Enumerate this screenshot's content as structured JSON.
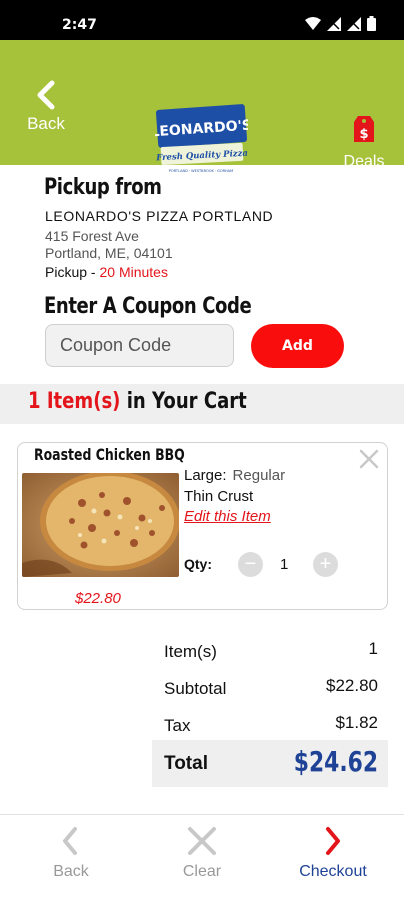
{
  "status_bar": {
    "time": "2:47"
  },
  "header": {
    "back_label": "Back",
    "deals_label": "Deals",
    "logo_text": "LEONARDO'S",
    "logo_tagline": "Fresh Quality Pizza",
    "logo_subtagline": "PORTLAND · WESTBROOK · GORHAM",
    "accent_color": "#a6c13a"
  },
  "pickup": {
    "title": "Pickup from",
    "store_name": "LEONARDO'S PIZZA PORTLAND",
    "address_line1": "415 Forest Ave",
    "address_line2": "Portland, ME, 04101",
    "method": "Pickup",
    "separator": " - ",
    "time": "20 Minutes"
  },
  "coupon": {
    "title": "Enter A Coupon Code",
    "placeholder": "Coupon Code",
    "add_label": "Add"
  },
  "cart": {
    "count": "1 Item(s)",
    "heading_suffix": " in Your Cart",
    "items": [
      {
        "name": "Roasted Chicken BBQ",
        "size_label": "Large:",
        "size_value": "Regular",
        "crust": "Thin Crust",
        "edit_label": "Edit this Item",
        "qty_label": "Qty:",
        "quantity": "1",
        "price": "$22.80"
      }
    ]
  },
  "summary": {
    "items_label": "Item(s)",
    "items_value": "1",
    "subtotal_label": "Subtotal",
    "subtotal_value": "$22.80",
    "tax_label": "Tax",
    "tax_value": "$1.82",
    "total_label": "Total",
    "total_value": "$24.62"
  },
  "bottom_nav": {
    "back_label": "Back",
    "clear_label": "Clear",
    "checkout_label": "Checkout"
  },
  "colors": {
    "red": "#e3151b",
    "blue": "#1e4296",
    "green": "#a6c13a"
  }
}
